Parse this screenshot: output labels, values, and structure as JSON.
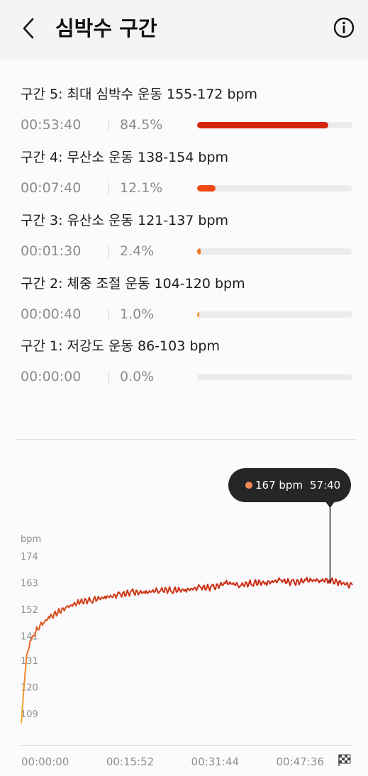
{
  "header": {
    "title": "심박수 구간",
    "back_icon": "chevron-left-icon",
    "info_icon": "info-icon"
  },
  "zones": [
    {
      "title": "구간 5: 최대 심박수 운동 155-172 bpm",
      "time": "00:53:40",
      "pct": "84.5%",
      "fraction": 0.845,
      "color": "#d2230e"
    },
    {
      "title": "구간 4: 무산소 운동 138-154 bpm",
      "time": "00:07:40",
      "pct": "12.1%",
      "fraction": 0.121,
      "color": "#ef4a16"
    },
    {
      "title": "구간 3: 유산소 운동 121-137 bpm",
      "time": "00:01:30",
      "pct": "2.4%",
      "fraction": 0.024,
      "color": "#f27325"
    },
    {
      "title": "구간 2: 체중 조절 운동 104-120 bpm",
      "time": "00:00:40",
      "pct": "1.0%",
      "fraction": 0.01,
      "color": "#f39b2d"
    },
    {
      "title": "구간 1: 저강도 운동 86-103 bpm",
      "time": "00:00:00",
      "pct": "0.0%",
      "fraction": 0.0,
      "color": "#f7c34a"
    }
  ],
  "tooltip": {
    "bpm": "167 bpm",
    "time": "57:40"
  },
  "chart_data": {
    "type": "line",
    "ylabel": "bpm",
    "yticks": [
      "174",
      "163",
      "152",
      "141",
      "131",
      "120",
      "109"
    ],
    "ytick_values": [
      174,
      163,
      152,
      141,
      131,
      120,
      109
    ],
    "ylim": [
      102,
      181
    ],
    "xticks": [
      "00:00:00",
      "00:15:52",
      "00:31:44",
      "00:47:36"
    ],
    "xtick_values": [
      0,
      952,
      1904,
      2856
    ],
    "xlim": [
      0,
      3710
    ],
    "grid": false,
    "end_icon": "finish-flag-icon",
    "series": [
      {
        "x": [
          0,
          30,
          60,
          100,
          150,
          200,
          260,
          330,
          420,
          520,
          650,
          800,
          950,
          1100,
          1250,
          1400,
          1550,
          1700,
          1850,
          2000,
          2150,
          2300,
          2450,
          2600,
          2750,
          2900,
          3050,
          3200,
          3350,
          3460,
          3550,
          3600,
          3650,
          3710
        ],
        "y": [
          105,
          120,
          133,
          139,
          142,
          145,
          147,
          149,
          151,
          153,
          155,
          156,
          157,
          158,
          159,
          159,
          160,
          160,
          160,
          161,
          161,
          163,
          162,
          163,
          163,
          164,
          163,
          164,
          164,
          164,
          163,
          163,
          162,
          162
        ]
      }
    ],
    "highlight": {
      "x": 3460,
      "y": 167
    }
  }
}
